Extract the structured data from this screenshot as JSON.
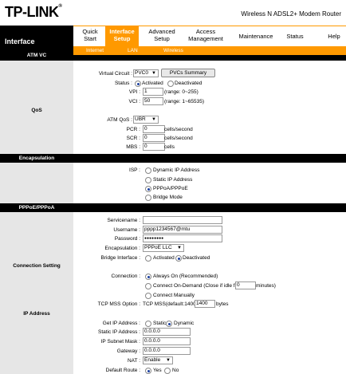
{
  "header": {
    "logo": "TP-LINK",
    "logo_mark": "®",
    "model": "Wireless N ADSL2+ Modem Router"
  },
  "nav": {
    "section_title": "Interface",
    "tabs": [
      {
        "line1": "Quick",
        "line2": "Start"
      },
      {
        "line1": "Interface",
        "line2": "Setup"
      },
      {
        "line1": "Advanced",
        "line2": "Setup"
      },
      {
        "line1": "Access",
        "line2": "Management"
      },
      {
        "line1": "Maintenance",
        "line2": ""
      },
      {
        "line1": "Status",
        "line2": ""
      },
      {
        "line1": "Help",
        "line2": ""
      }
    ],
    "subtabs": [
      "Internet",
      "LAN",
      "Wireless"
    ]
  },
  "atm_vc": {
    "section": "ATM VC",
    "virtual_circuit_label": "Virtual Circuit :",
    "virtual_circuit_value": "PVC0",
    "pvc_summary_button": "PVCs Summary",
    "status_label": "Status :",
    "status_activated": "Activated",
    "status_deactivated": "Deactivated",
    "vpi_label": "VPI :",
    "vpi_value": "1",
    "vpi_range": "(range: 0~255)",
    "vci_label": "VCI :",
    "vci_value": "50",
    "vci_range": "(range: 1~65535)"
  },
  "qos": {
    "section": "QoS",
    "atm_qos_label": "ATM QoS :",
    "atm_qos_value": "UBR",
    "pcr_label": "PCR :",
    "pcr_value": "0",
    "scr_label": "SCR :",
    "scr_value": "0",
    "mbs_label": "MBS :",
    "mbs_value": "0",
    "cells_second": "cells/second",
    "cells": "cells"
  },
  "encapsulation": {
    "section": "Encapsulation",
    "isp_label": "ISP :",
    "options": [
      "Dynamic IP Address",
      "Static IP Address",
      "PPPoA/PPPoE",
      "Bridge Mode"
    ]
  },
  "pppoe": {
    "section": "PPPoE/PPPoA",
    "servicename_label": "Servicename :",
    "servicename_value": "",
    "username_label": "Username :",
    "username_value": "pppp1234567@mtu",
    "password_label": "Password :",
    "password_value": "●●●●●●●●",
    "encap_label": "Encapsulation :",
    "encap_value": "PPPoE LLC",
    "bridge_label": "Bridge Interface :",
    "bridge_activated": "Activated",
    "bridge_deactivated": "Deactivated"
  },
  "connection": {
    "section": "Connection Setting",
    "connection_label": "Connection :",
    "always_on": "Always On (Recommended)",
    "on_demand": "Connect On-Demand (Close if idle for",
    "on_demand_value": "0",
    "minutes": "minutes)",
    "manually": "Connect Manually",
    "mss_label": "TCP MSS Option :",
    "mss_text": "TCP MSS(default:1400)",
    "mss_value": "1400",
    "bytes": "bytes"
  },
  "ip_address": {
    "section": "IP Address",
    "get_ip_label": "Get IP Address :",
    "static": "Static",
    "dynamic": "Dynamic",
    "static_ip_label": "Static IP Address :",
    "static_ip_value": "0.0.0.0",
    "subnet_label": "IP Subnet Mask :",
    "subnet_value": "0.0.0.0",
    "gateway_label": "Gateway :",
    "gateway_value": "0.0.0.0",
    "nat_label": "NAT :",
    "nat_value": "Enable",
    "default_route_label": "Default Route :",
    "yes": "Yes",
    "no": "No"
  }
}
